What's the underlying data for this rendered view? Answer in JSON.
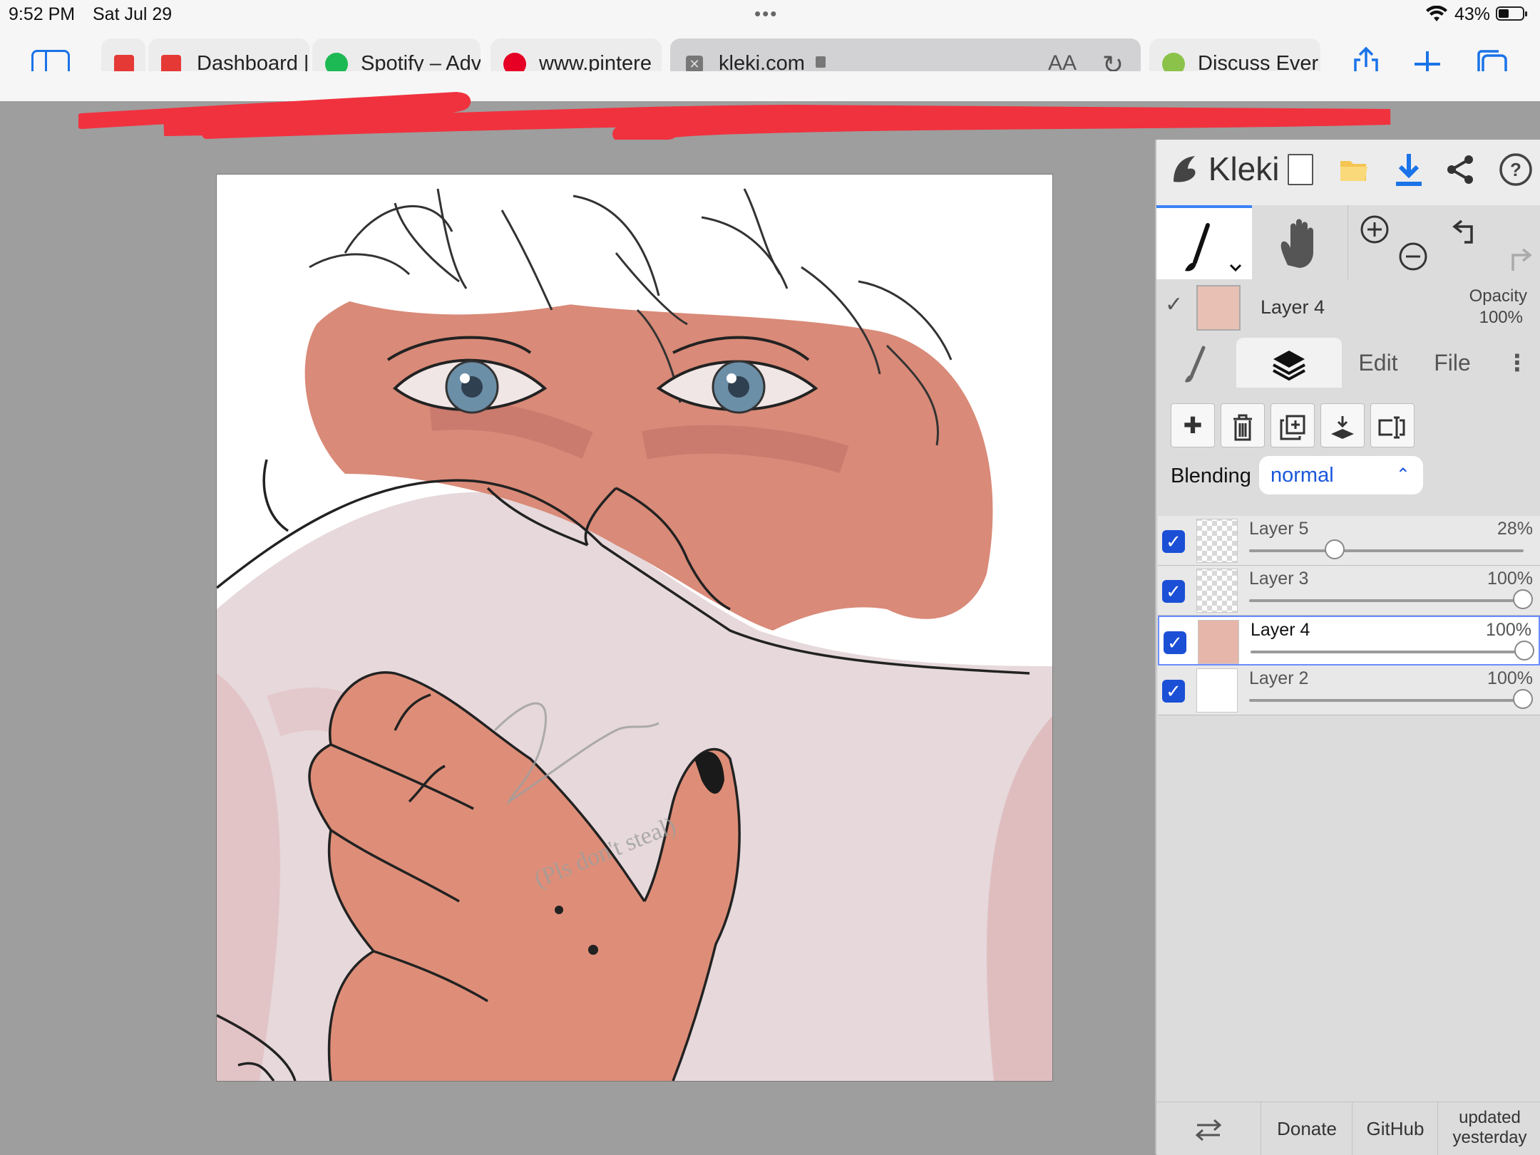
{
  "status_bar": {
    "time": "9:52 PM",
    "date": "Sat Jul 29",
    "battery": "43%"
  },
  "tabs": [
    {
      "title": "",
      "favicon_color": "#e53935"
    },
    {
      "title": "Dashboard |",
      "favicon_color": "#e53935"
    },
    {
      "title": "Spotify – Adv",
      "favicon_color": "#1db954"
    },
    {
      "title": "www.pintere",
      "favicon_color": "#e60023"
    },
    {
      "title": "kleki.com",
      "active": true
    },
    {
      "title": "Discuss Ever",
      "favicon_color": "#8bc34a"
    }
  ],
  "address_bar": {
    "aa_label": "AA"
  },
  "app": {
    "logo": "Kleki",
    "current_layer": {
      "name": "Layer 4",
      "opacity_label": "Opacity",
      "opacity": "100%"
    },
    "tabs": {
      "edit": "Edit",
      "file": "File"
    },
    "blending": {
      "label": "Blending",
      "value": "normal"
    },
    "layers": [
      {
        "name": "Layer 5",
        "opacity": "28%",
        "value": 0.28,
        "thumb": "checker",
        "selected": false
      },
      {
        "name": "Layer 3",
        "opacity": "100%",
        "value": 1.0,
        "thumb": "checker",
        "selected": false
      },
      {
        "name": "Layer 4",
        "opacity": "100%",
        "value": 1.0,
        "thumb": "skin",
        "selected": true
      },
      {
        "name": "Layer 2",
        "opacity": "100%",
        "value": 1.0,
        "thumb": "white",
        "selected": false
      }
    ],
    "footer": {
      "donate": "Donate",
      "github": "GitHub",
      "updated_1": "updated",
      "updated_2": "yesterday"
    }
  },
  "drawing": {
    "signature": "(Pls don't steal)"
  },
  "colors": {
    "accent": "#1a73e8",
    "checkbox": "#1b4fd6",
    "canvas_bg": "#9e9e9e",
    "skin": "#d98a78",
    "redact": "#f0323f"
  }
}
